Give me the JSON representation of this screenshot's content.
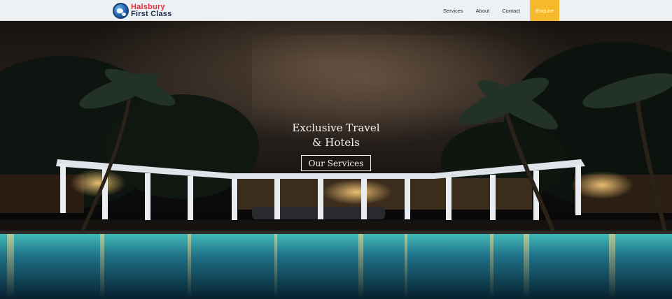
{
  "header": {
    "logo": {
      "line1": "Halsbury",
      "line2": "First Class",
      "icon": "globe-icon"
    },
    "nav": {
      "items": [
        "Services",
        "About",
        "Contact"
      ],
      "cta": "Enquire"
    }
  },
  "hero": {
    "title_line1": "Exclusive Travel",
    "title_line2": "& Hotels",
    "button": "Our Services"
  },
  "colors": {
    "header_bg": "#eef1f4",
    "accent": "#f5b92b",
    "logo_red": "#e0313a",
    "logo_navy": "#1b2b4a"
  }
}
